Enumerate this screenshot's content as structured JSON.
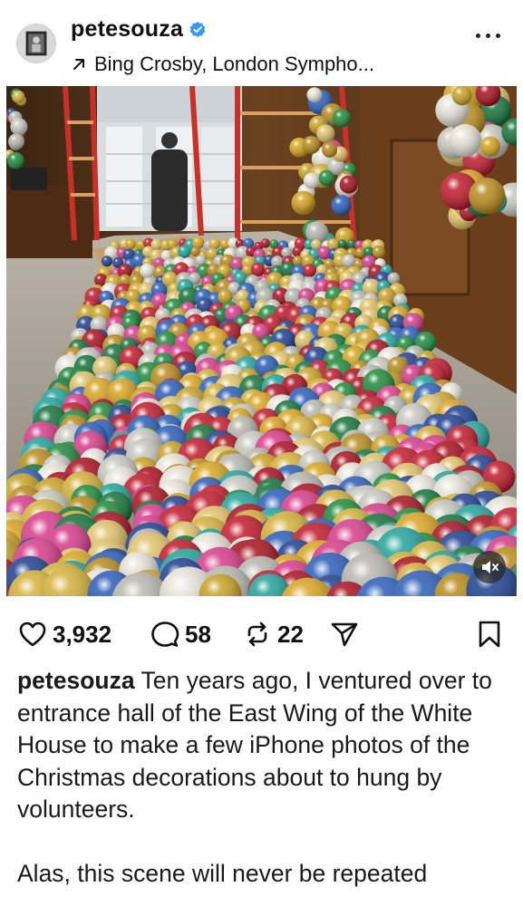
{
  "post": {
    "username": "petesouza",
    "verified_icon": "verified-badge-icon",
    "music": "Bing Crosby, London Sympho...",
    "music_icon": "arrow-up-right-icon",
    "more_icon": "more-dots-icon",
    "mute_icon": "speaker-muted-icon"
  },
  "actions": {
    "likes": "3,932",
    "comments": "58",
    "reposts": "22",
    "like_icon": "heart-icon",
    "comment_icon": "comment-bubble-icon",
    "repost_icon": "repost-icon",
    "share_icon": "send-icon",
    "save_icon": "bookmark-icon"
  },
  "caption": {
    "username": "petesouza",
    "text": "Ten years ago, I ventured over to entrance hall of the East Wing of the White House to make a few iPhone photos of the Christmas decorations about to hung by volunteers.",
    "text2": "Alas, this scene will never be repeated"
  },
  "colors": {
    "verified": "#3897f0",
    "text": "#111111"
  }
}
